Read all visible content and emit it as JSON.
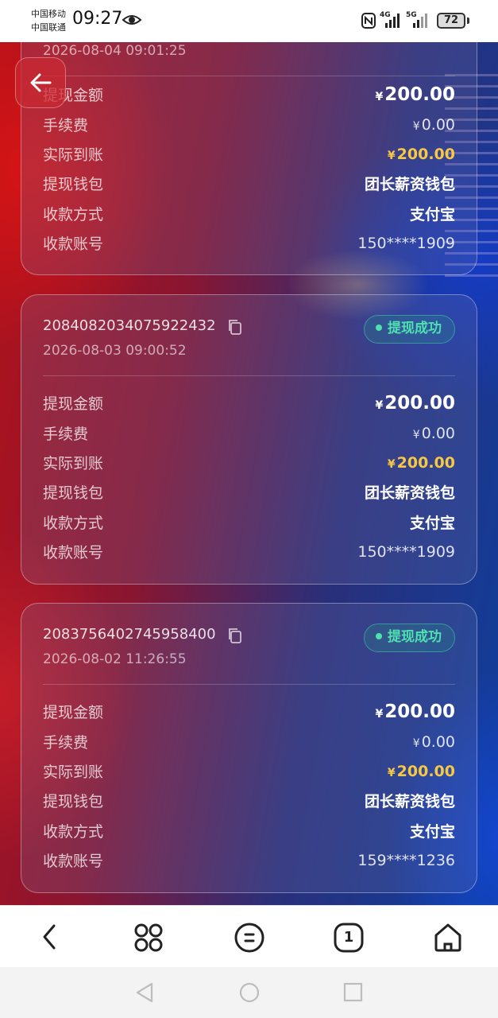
{
  "status_bar": {
    "carrier_1": "中国移动",
    "carrier_2": "中国联通",
    "time": "09:27",
    "net_1": "4G",
    "net_2": "5G",
    "battery": "72"
  },
  "records": [
    {
      "time": "2026-08-04 09:01:25",
      "rows": [
        {
          "label": "提现金额",
          "value": "200.00",
          "currency": "¥"
        },
        {
          "label": "手续费",
          "value": "0.00",
          "currency": "¥"
        },
        {
          "label": "实际到账",
          "value": "200.00",
          "currency": "¥"
        },
        {
          "label": "提现钱包",
          "value": "团长薪资钱包"
        },
        {
          "label": "收款方式",
          "value": "支付宝"
        },
        {
          "label": "收款账号",
          "value": "150****1909"
        }
      ]
    },
    {
      "order_no": "2084082034075922432",
      "time": "2026-08-03 09:00:52",
      "status": "提现成功",
      "rows": [
        {
          "label": "提现金额",
          "value": "200.00",
          "currency": "¥"
        },
        {
          "label": "手续费",
          "value": "0.00",
          "currency": "¥"
        },
        {
          "label": "实际到账",
          "value": "200.00",
          "currency": "¥"
        },
        {
          "label": "提现钱包",
          "value": "团长薪资钱包"
        },
        {
          "label": "收款方式",
          "value": "支付宝"
        },
        {
          "label": "收款账号",
          "value": "150****1909"
        }
      ]
    },
    {
      "order_no": "2083756402745958400",
      "time": "2026-08-02 11:26:55",
      "status": "提现成功",
      "rows": [
        {
          "label": "提现金额",
          "value": "200.00",
          "currency": "¥"
        },
        {
          "label": "手续费",
          "value": "0.00",
          "currency": "¥"
        },
        {
          "label": "实际到账",
          "value": "200.00",
          "currency": "¥"
        },
        {
          "label": "提现钱包",
          "value": "团长薪资钱包"
        },
        {
          "label": "收款方式",
          "value": "支付宝"
        },
        {
          "label": "收款账号",
          "value": "159****1236"
        }
      ]
    }
  ],
  "colors": {
    "status_green": "#4fe0b0",
    "amount_gold": "#f7c843"
  },
  "browser_bar": {
    "tab_count": "1",
    "icons": [
      "back-icon",
      "apps-icon",
      "menu-icon",
      "tabs-icon",
      "home-icon"
    ]
  },
  "system_nav": {
    "icons": [
      "nav-back-icon",
      "nav-home-icon",
      "nav-recents-icon"
    ]
  }
}
